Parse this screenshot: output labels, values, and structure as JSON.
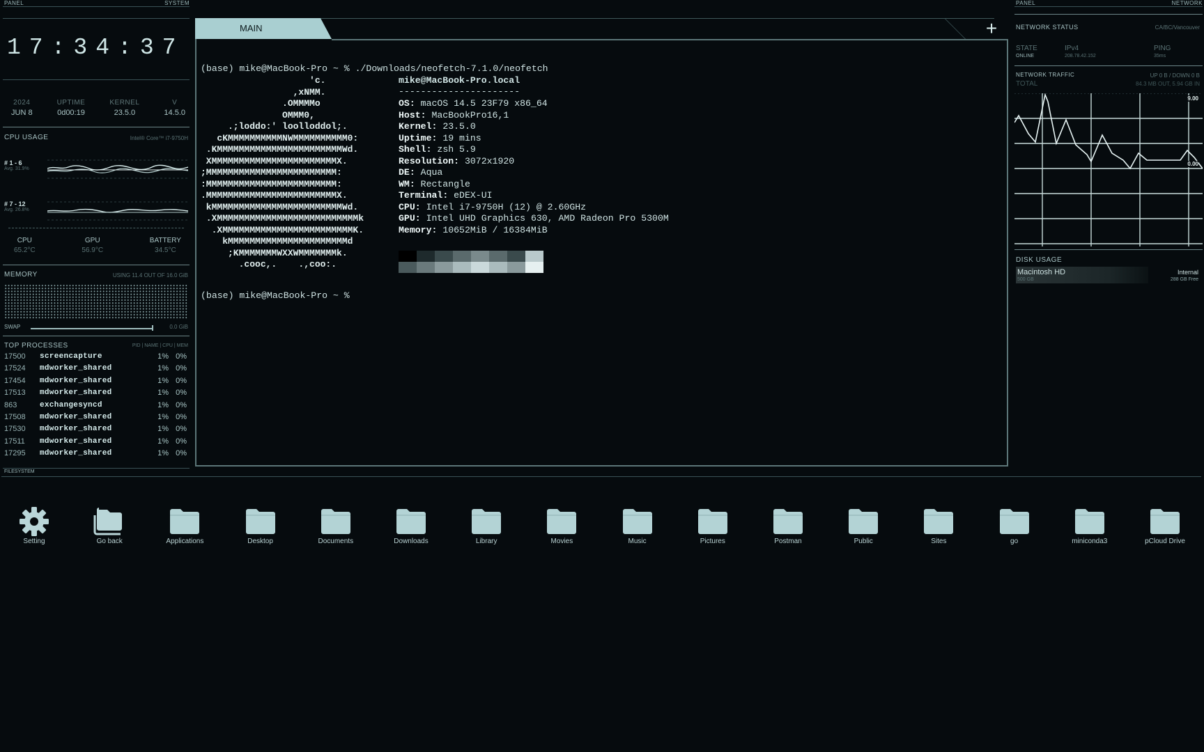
{
  "left_panel": {
    "header_left": "PANEL",
    "header_right": "SYSTEM",
    "clock": "17:34:37",
    "sysinfo": [
      {
        "label": "2024",
        "value": "JUN 8"
      },
      {
        "label": "UPTIME",
        "value": "0d00:19"
      },
      {
        "label": "KERNEL",
        "value": "23.5.0"
      },
      {
        "label": "V",
        "value": "14.5.0"
      }
    ],
    "cpu": {
      "title": "CPU USAGE",
      "model": "Intel® Core™ i7-9750H",
      "groups": [
        {
          "label": "# 1 - 6",
          "avg": "Avg. 31.9%"
        },
        {
          "label": "# 7 - 12",
          "avg": "Avg. 26.8%"
        }
      ],
      "temps": [
        {
          "label": "CPU",
          "value": "65.2°C"
        },
        {
          "label": "GPU",
          "value": "56.9°C"
        },
        {
          "label": "BATTERY",
          "value": "34.5°C"
        }
      ]
    },
    "memory": {
      "title": "MEMORY",
      "usage": "USING 11.4 OUT OF 16.0 GiB",
      "swap_label": "SWAP",
      "swap_value": "0.0 GiB"
    },
    "processes": {
      "title": "TOP PROCESSES",
      "columns": "PID | NAME | CPU | MEM",
      "rows": [
        {
          "pid": "17500",
          "name": "screencapture",
          "cpu": "1%",
          "mem": "0%"
        },
        {
          "pid": "17524",
          "name": "mdworker_shared",
          "cpu": "1%",
          "mem": "0%"
        },
        {
          "pid": "17454",
          "name": "mdworker_shared",
          "cpu": "1%",
          "mem": "0%"
        },
        {
          "pid": "17513",
          "name": "mdworker_shared",
          "cpu": "1%",
          "mem": "0%"
        },
        {
          "pid": "863",
          "name": "exchangesyncd",
          "cpu": "1%",
          "mem": "0%"
        },
        {
          "pid": "17508",
          "name": "mdworker_shared",
          "cpu": "1%",
          "mem": "0%"
        },
        {
          "pid": "17530",
          "name": "mdworker_shared",
          "cpu": "1%",
          "mem": "0%"
        },
        {
          "pid": "17511",
          "name": "mdworker_shared",
          "cpu": "1%",
          "mem": "0%"
        },
        {
          "pid": "17295",
          "name": "mdworker_shared",
          "cpu": "1%",
          "mem": "0%"
        }
      ]
    }
  },
  "terminal": {
    "tab_label": "MAIN",
    "new_tab_icon": "plus-icon",
    "command_line": "(base) mike@MacBook-Pro ~ % ./Downloads/neofetch-7.1.0/neofetch",
    "ascii_art": "                    'c.\n                 ,xNMM.\n               .OMMMMo\n               OMMM0,\n     .;loddo:' loolloddol;.\n   cKMMMMMMMMMMNWMMMMMMMMMM0:\n .KMMMMMMMMMMMMMMMMMMMMMMMWd.\n XMMMMMMMMMMMMMMMMMMMMMMMX.\n;MMMMMMMMMMMMMMMMMMMMMMMM:\n:MMMMMMMMMMMMMMMMMMMMMMMM:\n.MMMMMMMMMMMMMMMMMMMMMMMMX.\n kMMMMMMMMMMMMMMMMMMMMMMMMWd.\n .XMMMMMMMMMMMMMMMMMMMMMMMMMMk\n  .XMMMMMMMMMMMMMMMMMMMMMMMMK.\n    kMMMMMMMMMMMMMMMMMMMMMMd\n     ;KMMMMMMMWXXWMMMMMMMk.\n       .cooc,.    .,coo:.",
    "host_line": "mike@MacBook-Pro.local",
    "separator": "----------------------",
    "info": [
      {
        "key": "OS",
        "value": "macOS 14.5 23F79 x86_64"
      },
      {
        "key": "Host",
        "value": "MacBookPro16,1"
      },
      {
        "key": "Kernel",
        "value": "23.5.0"
      },
      {
        "key": "Uptime",
        "value": "19 mins"
      },
      {
        "key": "Shell",
        "value": "zsh 5.9"
      },
      {
        "key": "Resolution",
        "value": "3072x1920"
      },
      {
        "key": "DE",
        "value": "Aqua"
      },
      {
        "key": "WM",
        "value": "Rectangle"
      },
      {
        "key": "Terminal",
        "value": "eDEX-UI"
      },
      {
        "key": "CPU",
        "value": "Intel i7-9750H (12) @ 2.60GHz"
      },
      {
        "key": "GPU",
        "value": "Intel UHD Graphics 630, AMD Radeon Pro 5300M"
      },
      {
        "key": "Memory",
        "value": "10652MiB / 16384MiB"
      }
    ],
    "palette_top": [
      "#000000",
      "#1e2a2c",
      "#3a4a4c",
      "#5a6a6c",
      "#7a8a8c",
      "#5a6a6c",
      "#3a4a4c",
      "#b9c9cb"
    ],
    "palette_bottom": [
      "#4a5a5c",
      "#6a7a7c",
      "#8a9a9c",
      "#aabbbd",
      "#cad9db",
      "#aabbbd",
      "#8a9a9c",
      "#e6f0f0"
    ],
    "prompt_line": "(base) mike@MacBook-Pro ~ %"
  },
  "right_panel": {
    "header_left": "PANEL",
    "header_right": "NETWORK",
    "status": {
      "title": "NETWORK STATUS",
      "location": "CA/BC/Vancouver",
      "state_label": "STATE",
      "state_value": "ONLINE",
      "ip_label": "IPv4",
      "ip_value": "208.78.42.152",
      "ping_label": "PING",
      "ping_value": "35ms"
    },
    "traffic": {
      "title": "NETWORK TRAFFIC",
      "updown": "UP 0 B / DOWN 0 B",
      "total_label": "TOTAL",
      "total_value": "84.3 MB OUT, 5.94 GB IN",
      "scale_top": "9.00",
      "scale_bottom": "0.00"
    },
    "disk": {
      "title": "DISK USAGE",
      "name": "Macintosh HD",
      "type": "Internal",
      "size": "500 GB",
      "free": "288 GB Free",
      "used_fraction": 0.42
    }
  },
  "filesystem": {
    "title": "FILESYSTEM",
    "items": [
      {
        "label": "Setting",
        "icon": "gear-icon"
      },
      {
        "label": "Go back",
        "icon": "go-back-icon"
      },
      {
        "label": "Applications",
        "icon": "folder-icon"
      },
      {
        "label": "Desktop",
        "icon": "folder-icon"
      },
      {
        "label": "Documents",
        "icon": "folder-icon"
      },
      {
        "label": "Downloads",
        "icon": "folder-icon"
      },
      {
        "label": "Library",
        "icon": "folder-icon"
      },
      {
        "label": "Movies",
        "icon": "folder-icon"
      },
      {
        "label": "Music",
        "icon": "folder-icon"
      },
      {
        "label": "Pictures",
        "icon": "folder-icon"
      },
      {
        "label": "Postman",
        "icon": "folder-icon"
      },
      {
        "label": "Public",
        "icon": "folder-icon"
      },
      {
        "label": "Sites",
        "icon": "folder-icon"
      },
      {
        "label": "go",
        "icon": "folder-icon"
      },
      {
        "label": "miniconda3",
        "icon": "folder-icon"
      },
      {
        "label": "pCloud Drive",
        "icon": "folder-icon"
      }
    ]
  },
  "colors": {
    "background": "#060b0e",
    "accent": "#a9cfd1",
    "text": "#cfe3e3"
  }
}
